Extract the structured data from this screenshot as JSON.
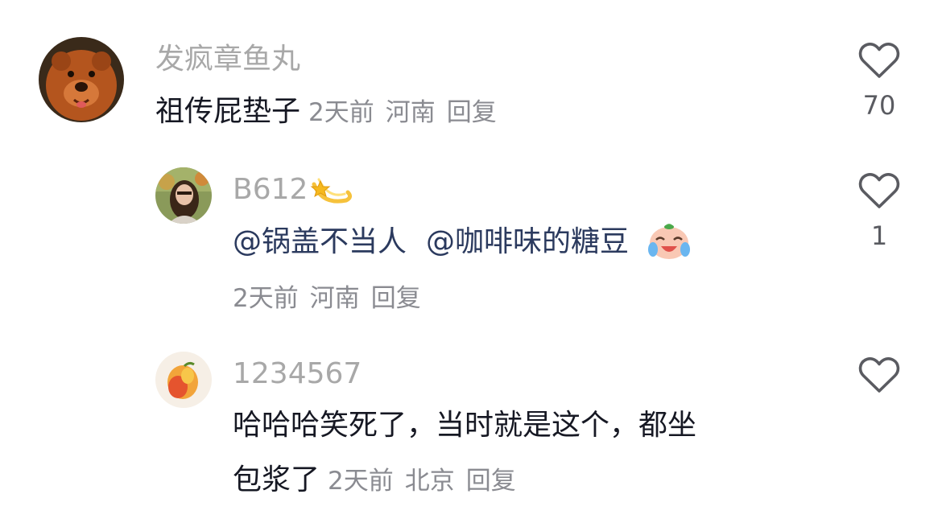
{
  "comments": [
    {
      "username": "发疯章鱼丸",
      "text": "祖传屁垫子",
      "time": "2天前",
      "location": "河南",
      "reply_label": "回复",
      "likes": "70"
    },
    {
      "username": "B612",
      "mentions": [
        "@锅盖不当人",
        "@咖啡味的糖豆"
      ],
      "time": "2天前",
      "location": "河南",
      "reply_label": "回复",
      "likes": "1",
      "username_emoji": "dizzy-star-emoji",
      "content_emoji": "crying-laughing-face-emoji"
    },
    {
      "username": "1234567",
      "text_line1": "哈哈哈笑死了，当时就是这个，都坐",
      "text_line2": "包浆了",
      "time": "2天前",
      "location": "北京",
      "reply_label": "回复"
    }
  ],
  "colors": {
    "username": "#a8a8a8",
    "text": "#161823",
    "meta": "#8a8b91",
    "mention": "#2b3a5e",
    "heart_stroke": "#5a5b61"
  }
}
